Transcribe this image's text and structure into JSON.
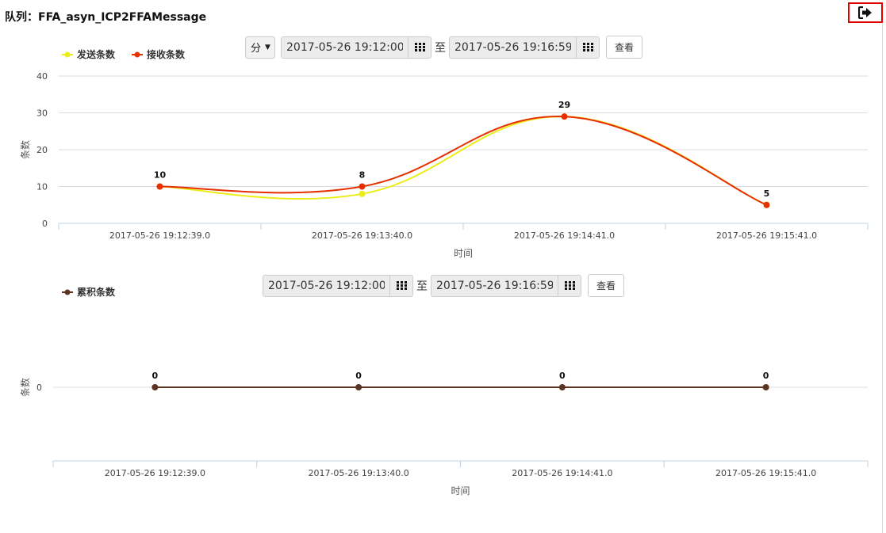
{
  "page": {
    "title": "队列：FFA_asyn_ICP2FFAMessage",
    "exit_icon": "sign-out-icon"
  },
  "toolbar1": {
    "unit_label": "分",
    "start": "2017-05-26 19:12:00",
    "to_label": "至",
    "end": "2017-05-26 19:16:59",
    "query_label": "查看",
    "calendar_icon": "grid-calendar-icon"
  },
  "toolbar2": {
    "start": "2017-05-26 19:12:00",
    "to_label": "至",
    "end": "2017-05-26 19:16:59",
    "query_label": "查看",
    "calendar_icon": "grid-calendar-icon"
  },
  "chart_data": [
    {
      "type": "line",
      "smooth": true,
      "categories": [
        "2017-05-26 19:12:39.0",
        "2017-05-26 19:13:40.0",
        "2017-05-26 19:14:41.0",
        "2017-05-26 19:15:41.0"
      ],
      "series": [
        {
          "name": "发送条数",
          "color": "#ecec18",
          "values": [
            10,
            8,
            29,
            5
          ]
        },
        {
          "name": "接收条数",
          "color": "#e63000",
          "values": [
            10,
            10,
            29,
            5
          ]
        }
      ],
      "data_labels": [
        "10",
        "8",
        "29",
        "5"
      ],
      "xlabel": "时间",
      "ylabel": "条数",
      "ylim": [
        0,
        40
      ],
      "yticks": [
        "0",
        "10",
        "20",
        "30",
        "40"
      ],
      "grid": true,
      "legend_position": "top-left"
    },
    {
      "type": "line",
      "categories": [
        "2017-05-26 19:12:39.0",
        "2017-05-26 19:13:40.0",
        "2017-05-26 19:14:41.0",
        "2017-05-26 19:15:41.0"
      ],
      "series": [
        {
          "name": "累积条数",
          "color": "#5b3423",
          "values": [
            0,
            0,
            0,
            0
          ]
        }
      ],
      "data_labels": [
        "0",
        "0",
        "0",
        "0"
      ],
      "xlabel": "时间",
      "ylabel": "条数",
      "yticks": [
        "0"
      ],
      "grid": true,
      "legend_position": "top-left"
    }
  ]
}
